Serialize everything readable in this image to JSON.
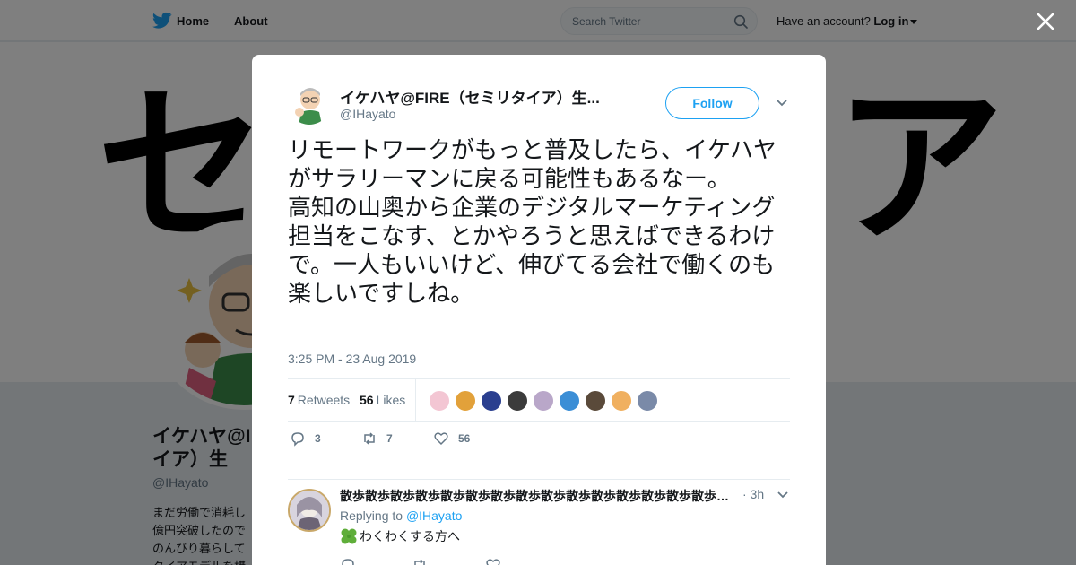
{
  "topbar": {
    "home_label": "Home",
    "about_label": "About",
    "search_placeholder": "Search Twitter",
    "account_prompt": "Have an account?",
    "login_label": "Log in"
  },
  "banner": {
    "glyph_left": "セ",
    "glyph_right": "ア"
  },
  "profile": {
    "name": "イケハヤ@FIRE（セミリタイア）生活",
    "name_visible": "イケハヤ@I タイア）生",
    "handle": "@IHayato",
    "bio_lines": [
      "まだ労働で消耗し",
      "億円突破したので",
      "のんびり暮らして",
      "タイアモデルを構"
    ]
  },
  "tweet": {
    "author_name": "イケハヤ@FIRE（セミリタイア）生...",
    "author_handle": "@IHayato",
    "follow_label": "Follow",
    "text": "リモートワークがもっと普及したら、イケハヤがサラリーマンに戻る可能性もあるなー。\n高知の山奥から企業のデジタルマーケティング担当をこなす、とかやろうと思えばできるわけで。一人もいいけど、伸びてる会社で働くのも楽しいですしね。",
    "timestamp": "3:25 PM - 23 Aug 2019",
    "retweets_count": "7",
    "retweets_label": "Retweets",
    "likes_count": "56",
    "likes_label": "Likes",
    "likers_colors": [
      "#f3c6d3",
      "#e2a13a",
      "#2a3f8f",
      "#3b3b3b",
      "#b9a7c9",
      "#3b8ed6",
      "#5a4a3a",
      "#f0b060",
      "#7a8aa8"
    ],
    "actions": {
      "reply_count": "3",
      "retweet_count": "7",
      "like_count": "56"
    }
  },
  "reply": {
    "name": "散歩散歩散歩散歩散歩散歩散歩散歩散歩散歩散歩散歩散歩散歩散歩散歩散歩",
    "time": "· 3h",
    "replying_prefix": "Replying to",
    "replying_handle": "@IHayato",
    "text": "わくわくする方へ"
  },
  "colors": {
    "accent": "#1da1f2",
    "secondary_text": "#657786",
    "border": "#e6ecf0"
  }
}
